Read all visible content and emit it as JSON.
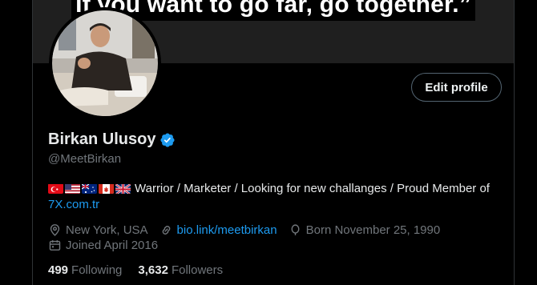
{
  "banner": {
    "quote": "If you want to go far, go together.”"
  },
  "profile": {
    "edit_label": "Edit profile",
    "name": "Birkan Ulusoy",
    "handle": "@MeetBirkan",
    "bio_text": "Warrior / Marketer / Looking for new challanges / Proud Member of",
    "bio_link": "7X.com.tr",
    "flags": [
      "turkey-flag",
      "usa-flag",
      "australia-flag",
      "canada-flag",
      "uk-flag"
    ],
    "location": "New York, USA",
    "website": "bio.link/meetbirkan",
    "birthday": "Born November 25, 1990",
    "joined": "Joined April 2016",
    "following_count": "499",
    "following_label": "Following",
    "followers_count": "3,632",
    "followers_label": "Followers"
  },
  "colors": {
    "accent": "#1d9bf0",
    "muted": "#71767b",
    "background": "#000000"
  }
}
